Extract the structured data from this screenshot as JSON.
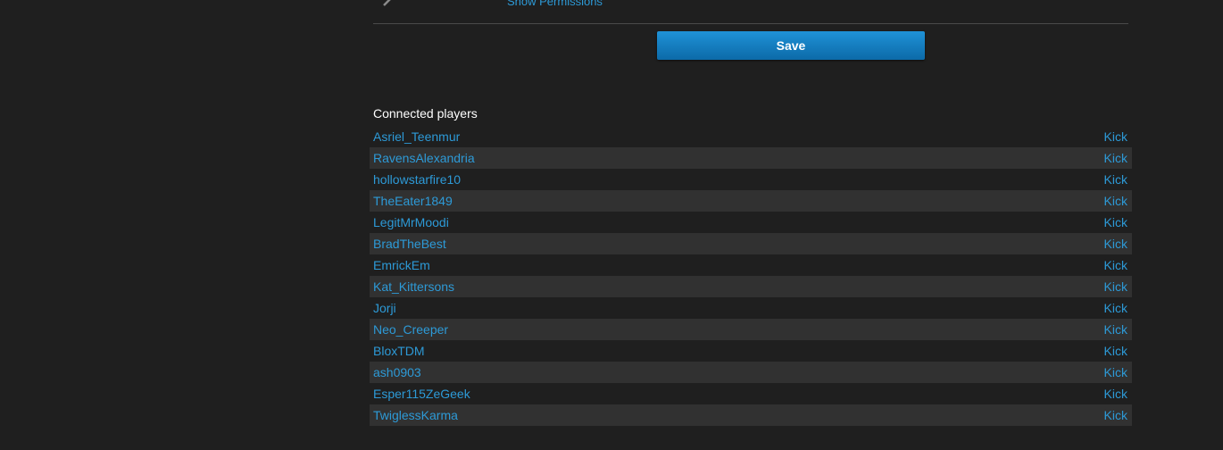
{
  "permissions": {
    "link_label": "Show Permissions"
  },
  "form": {
    "save_label": "Save"
  },
  "players": {
    "title": "Connected players",
    "kick_label": "Kick",
    "list": [
      "Asriel_Teenmur",
      "RavensAlexandria",
      "hollowstarfire10",
      "TheEater1849",
      "LegitMrMoodi",
      "BradTheBest",
      "EmrickEm",
      "Kat_Kittersons",
      "Jorji",
      "Neo_Creeper",
      "BloxTDM",
      "ash0903",
      "Esper115ZeGeek",
      "TwiglessKarma"
    ]
  },
  "colors": {
    "background": "#1f1f1f",
    "row_alt": "#313131",
    "link": "#2d9ad7",
    "button": "#1780c2"
  },
  "icons": {
    "expand": "chevron-right-icon"
  }
}
